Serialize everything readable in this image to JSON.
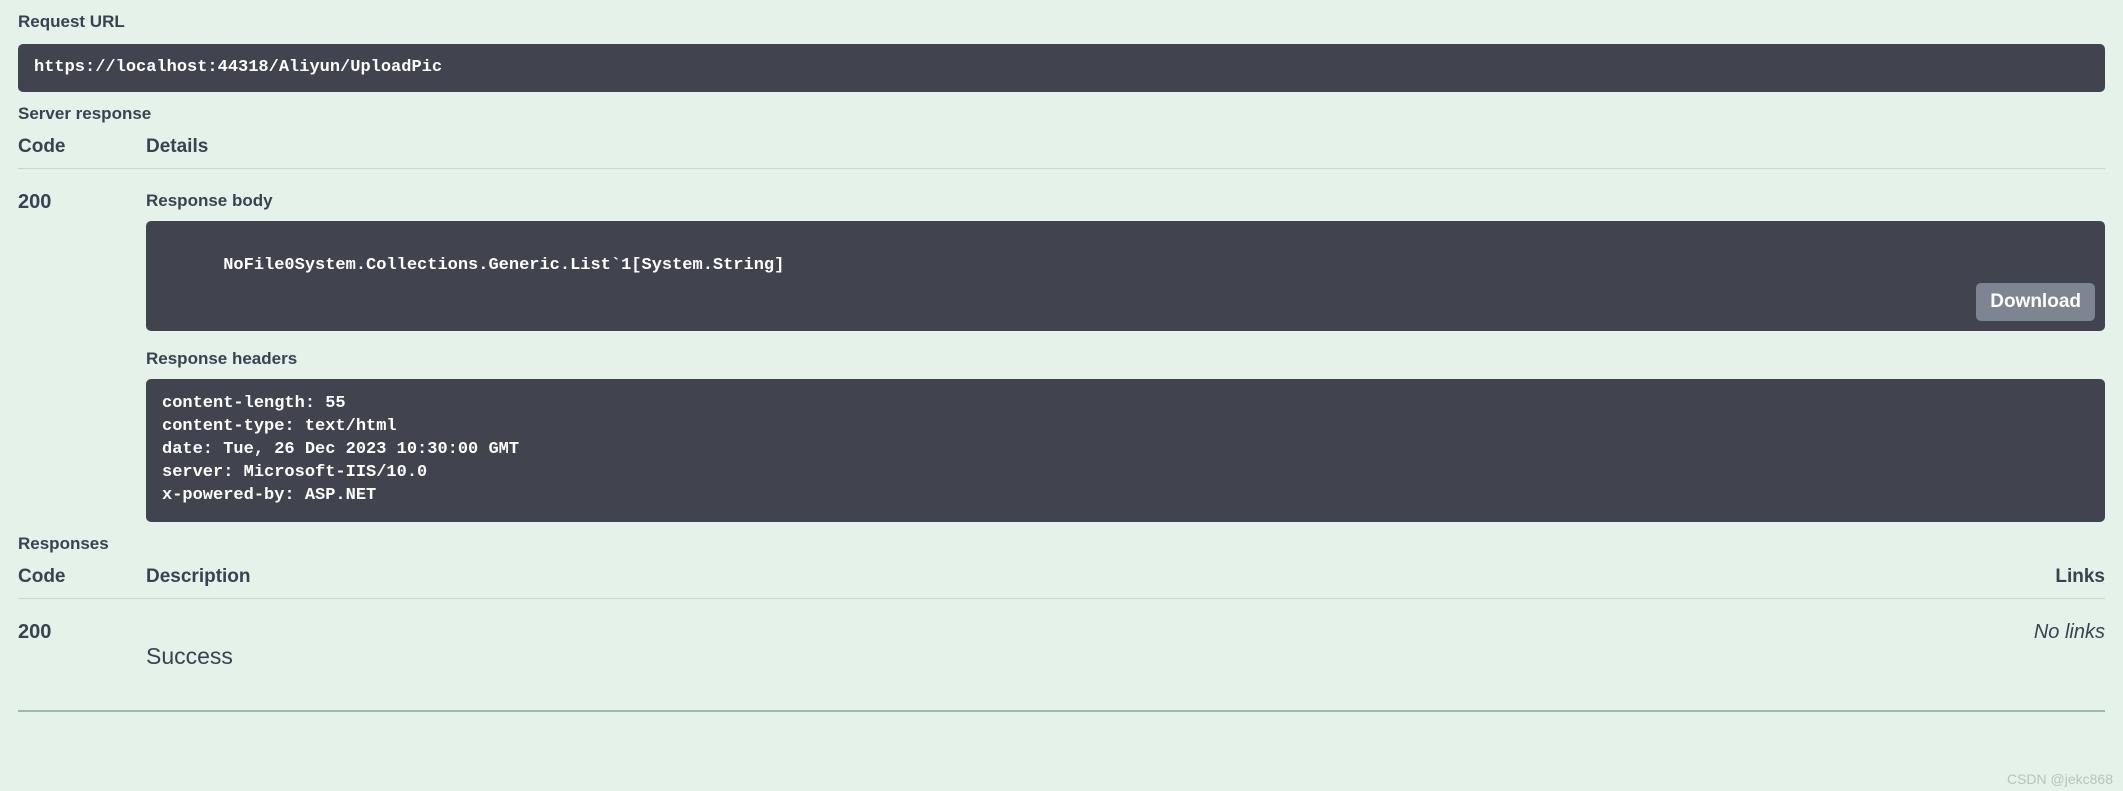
{
  "request": {
    "url_label": "Request URL",
    "url": "https://localhost:44318/Aliyun/UploadPic"
  },
  "server_response": {
    "label": "Server response",
    "headers": {
      "code": "Code",
      "details": "Details"
    },
    "code": "200",
    "body_label": "Response body",
    "body": "NoFile0System.Collections.Generic.List`1[System.String]",
    "download_label": "Download",
    "headers_label": "Response headers",
    "headers_text": "content-length: 55\ncontent-type: text/html\ndate: Tue, 26 Dec 2023 10:30:00 GMT\nserver: Microsoft-IIS/10.0\nx-powered-by: ASP.NET"
  },
  "responses": {
    "label": "Responses",
    "headers": {
      "code": "Code",
      "description": "Description",
      "links": "Links"
    },
    "rows": [
      {
        "code": "200",
        "description": "Success",
        "links": "No links"
      }
    ]
  },
  "watermark": "CSDN @jekc868"
}
